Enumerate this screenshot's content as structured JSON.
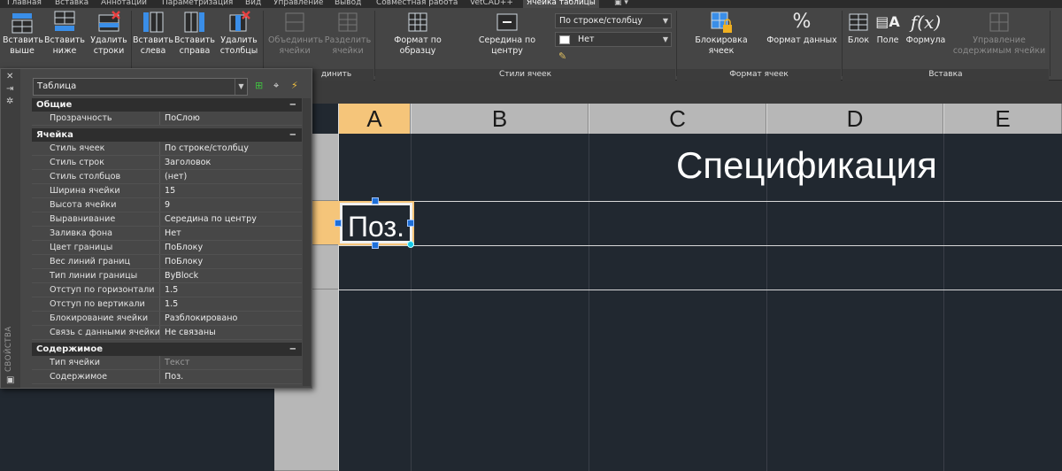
{
  "menu_tabs": [
    "Главная",
    "Вставка",
    "Аннотации",
    "Параметризация",
    "Вид",
    "Управление",
    "Вывод",
    "Совместная работа",
    "VetCAD++",
    "Ячейка таблицы"
  ],
  "active_tab": "Ячейка таблицы",
  "ribbon": {
    "rows_group": {
      "insert_above": "Вставить\nвыше",
      "insert_below": "Вставить\nниже",
      "delete_rows": "Удалить\nстроки"
    },
    "columns_group": {
      "insert_left": "Вставить\nслева",
      "insert_right": "Вставить\nсправа",
      "delete_columns": "Удалить\nстолбцы"
    },
    "merge_group": {
      "merge_cells": "Объединить\nячейки",
      "unmerge_cells": "Разделить\nячейки",
      "name": "динить"
    },
    "cell_styles_group": {
      "match_cell": "Формат по образцу",
      "alignment": "Середина по центру",
      "style_combo": "По строке/столбцу",
      "fill_combo": "Нет",
      "name": "Стили ячеек"
    },
    "cell_format_group": {
      "cell_locking": "Блокировка ячеек",
      "data_format": "Формат данных",
      "name": "Формат ячеек"
    },
    "insert_group": {
      "block": "Блок",
      "field": "Поле",
      "formula": "Формула",
      "manage_contents": "Управление\nсодержимым ячейки",
      "name": "Вставка"
    }
  },
  "drawing": {
    "column_headers": [
      "A",
      "B",
      "C",
      "D",
      "E"
    ],
    "row_header_visible": "4",
    "title_text": "Спецификация",
    "selected_cell_text": "Поз."
  },
  "properties": {
    "vertical_title": "СВОЙСТВА",
    "object_type": "Таблица",
    "sections": [
      {
        "title": "Общие",
        "rows": [
          {
            "key": "Прозрачность",
            "value": "ПоСлою"
          }
        ]
      },
      {
        "title": "Ячейка",
        "rows": [
          {
            "key": "Стиль ячеек",
            "value": "По строке/столбцу"
          },
          {
            "key": "Стиль строк",
            "value": "Заголовок"
          },
          {
            "key": "Стиль столбцов",
            "value": "(нет)"
          },
          {
            "key": "Ширина ячейки",
            "value": "15"
          },
          {
            "key": "Высота ячейки",
            "value": "9"
          },
          {
            "key": "Выравнивание",
            "value": "Середина по центру"
          },
          {
            "key": "Заливка фона",
            "value": " Нет"
          },
          {
            "key": "Цвет границы",
            "value": "ПоБлоку"
          },
          {
            "key": "Вес линий границ",
            "value": "ПоБлоку"
          },
          {
            "key": "Тип линии границы",
            "value": "ByBlock"
          },
          {
            "key": "Отступ по горизонтали",
            "value": "1.5"
          },
          {
            "key": "Отступ по вертикали",
            "value": "1.5"
          },
          {
            "key": "Блокирование ячейки",
            "value": "Разблокировано"
          },
          {
            "key": "Связь с данными ячейки",
            "value": "Не связаны"
          }
        ]
      },
      {
        "title": "Содержимое",
        "rows": [
          {
            "key": "Тип ячейки",
            "value": "Текст",
            "muted": true
          },
          {
            "key": "Содержимое",
            "value": "Поз."
          }
        ]
      }
    ],
    "collapse_glyph": "−"
  }
}
